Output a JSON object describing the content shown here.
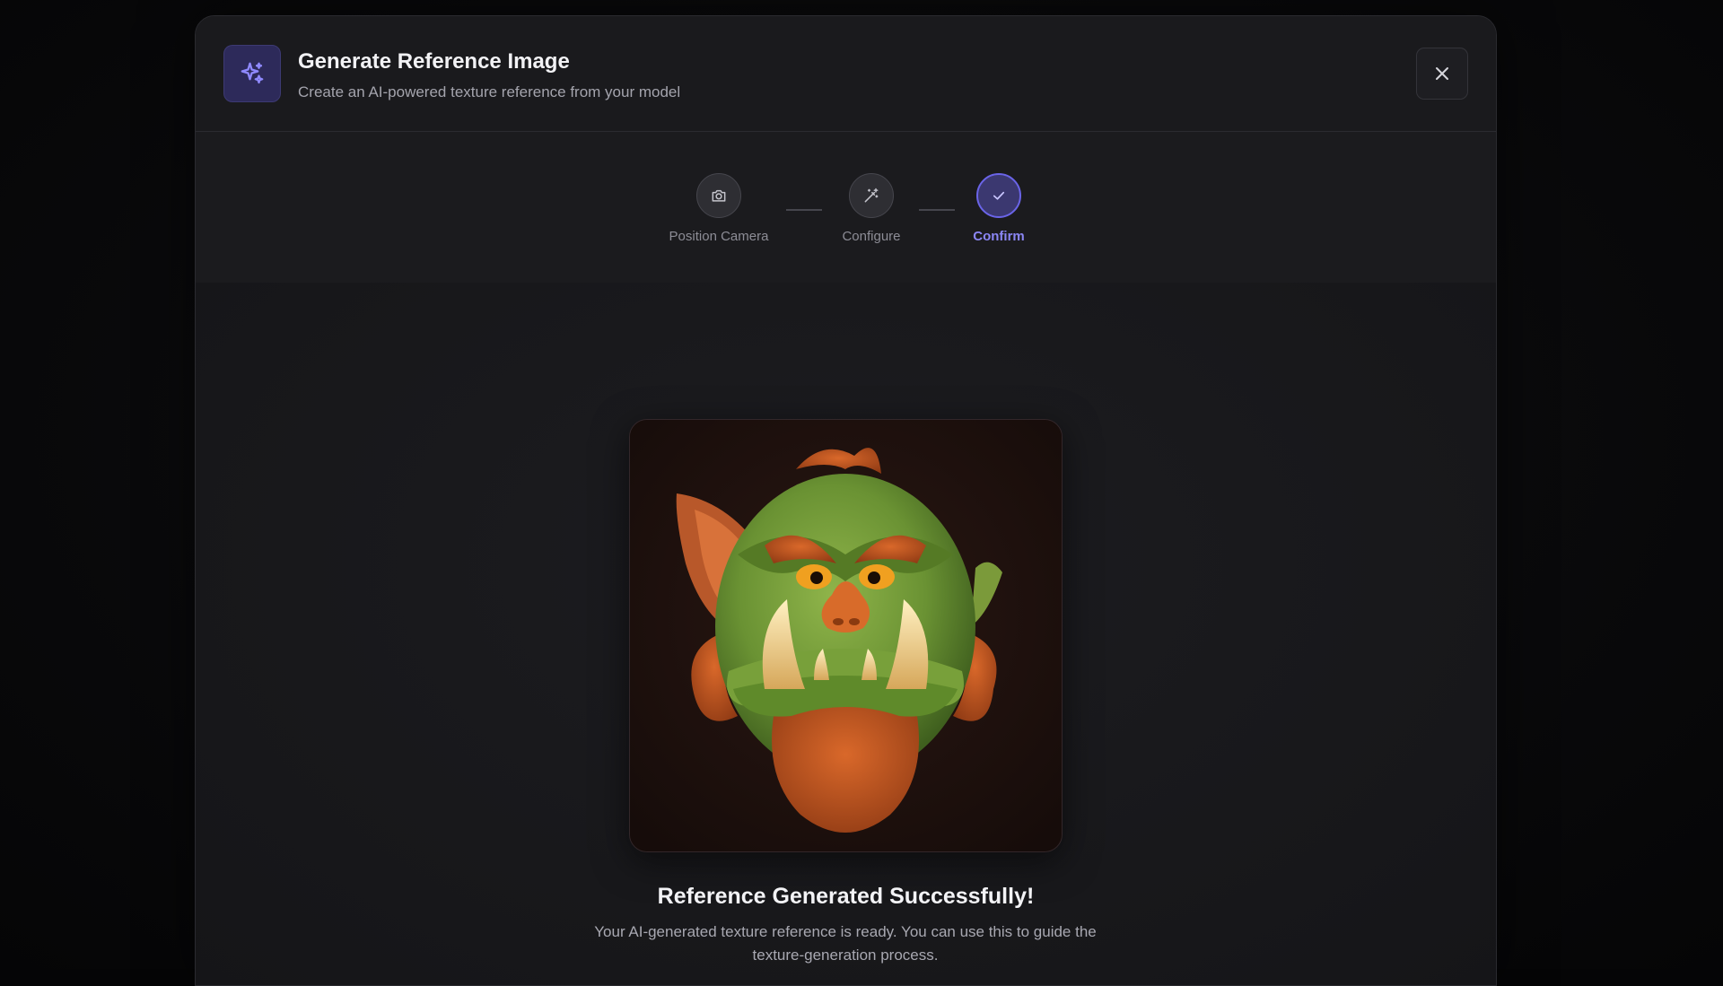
{
  "dialog": {
    "title": "Generate Reference Image",
    "subtitle": "Create an AI-powered texture reference from your model",
    "header_icon": "sparkles-icon",
    "close_icon": "close-icon"
  },
  "steps": [
    {
      "label": "Position Camera",
      "icon": "camera-icon",
      "state": "completed"
    },
    {
      "label": "Configure",
      "icon": "magic-wand-icon",
      "state": "completed"
    },
    {
      "label": "Confirm",
      "icon": "check-icon",
      "state": "active"
    }
  ],
  "result": {
    "image_subject": "stylized green orc head with tusks and orange beard",
    "title": "Reference Generated Successfully!",
    "description": "Your AI-generated texture reference is ready. You can use this to guide the texture-generation process."
  },
  "colors": {
    "accent": "#6a64e8",
    "accent_text": "#8b86f5",
    "background": "#19191c"
  }
}
